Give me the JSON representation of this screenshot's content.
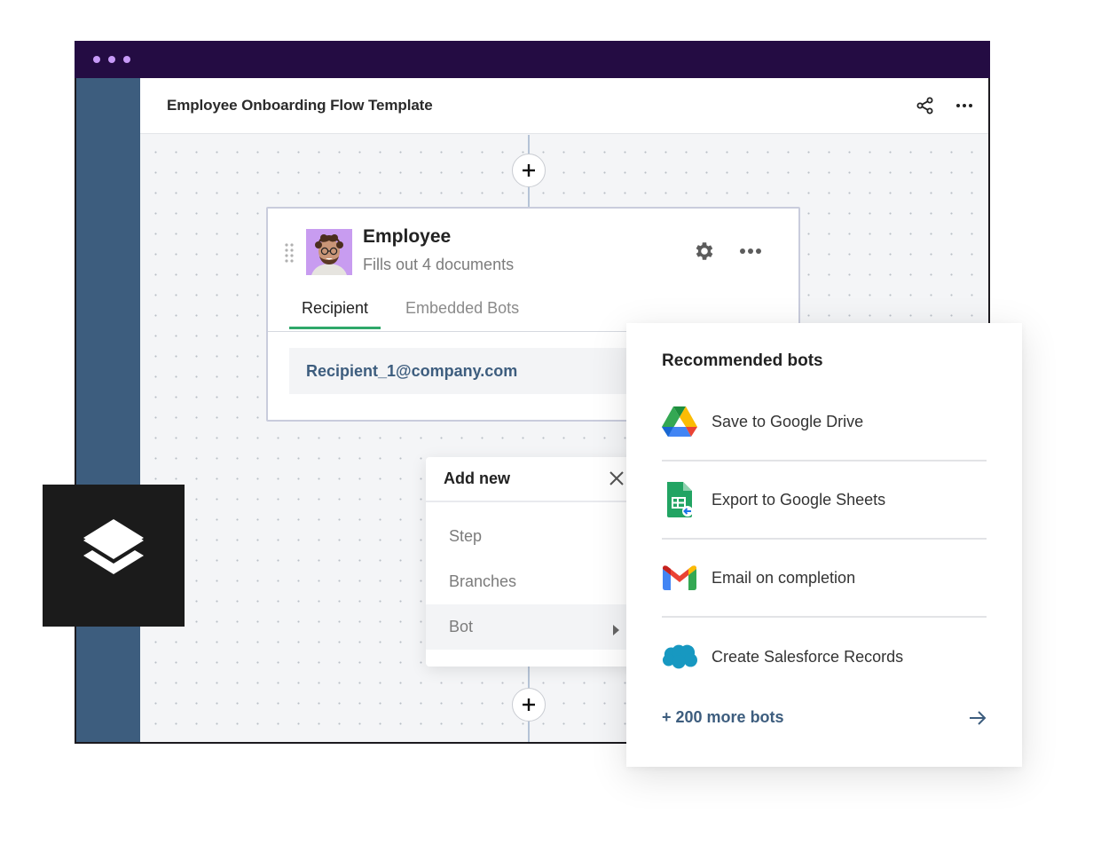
{
  "window": {
    "title": "Employee Onboarding Flow Template",
    "titlebar_dots": [
      "dot",
      "dot",
      "dot"
    ],
    "header_actions": [
      {
        "icon": "share-icon"
      },
      {
        "icon": "more-horizontal-icon"
      }
    ]
  },
  "canvas": {
    "add_step_buttons": [
      {
        "icon": "plus-icon"
      },
      {
        "icon": "plus-icon"
      }
    ]
  },
  "step_card": {
    "name": "Employee",
    "subtitle": "Fills out 4 documents",
    "avatar_bg": "#c89cf0",
    "actions": [
      {
        "icon": "gear-icon"
      },
      {
        "icon": "more-horizontal-icon"
      }
    ],
    "tabs": [
      {
        "label": "Recipient",
        "active": true
      },
      {
        "label": "Embedded Bots",
        "active": false
      }
    ],
    "recipient_email": "Recipient_1@company.com",
    "accent_color": "#2fa86a"
  },
  "add_menu": {
    "title": "Add new",
    "items": [
      {
        "label": "Step",
        "highlighted": false
      },
      {
        "label": "Branches",
        "highlighted": false
      },
      {
        "label": "Bot",
        "highlighted": true,
        "has_submenu": true
      }
    ]
  },
  "bots_panel": {
    "title": "Recommended bots",
    "items": [
      {
        "label": "Save to Google Drive",
        "icon": "google-drive-icon"
      },
      {
        "label": "Export to Google Sheets",
        "icon": "google-sheets-icon"
      },
      {
        "label": "Email on completion",
        "icon": "gmail-icon"
      },
      {
        "label": "Create Salesforce Records",
        "icon": "salesforce-icon"
      }
    ],
    "more_link": "+ 200 more bots",
    "link_color": "#3d5d7e"
  },
  "badge": {
    "icon": "layers-icon"
  },
  "colors": {
    "titlebar": "#240c43",
    "titlebar_dots": "#c79af7",
    "sidebar": "#3d5d7e",
    "canvas": "#f4f5f7"
  }
}
